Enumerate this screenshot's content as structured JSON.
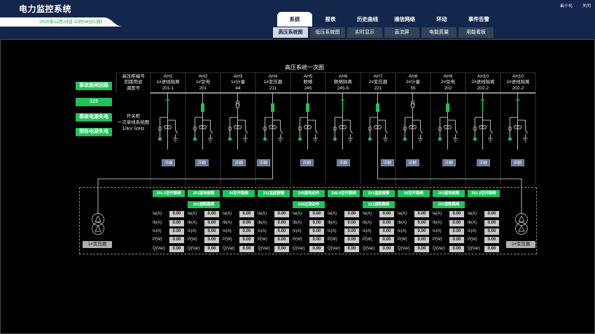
{
  "app": {
    "title": "电力监控系统",
    "datetime": "2020年11月24日 11时04分13秒",
    "minimize_label": "最小化",
    "close_label": "关闭"
  },
  "main_nav": [
    {
      "label": "系统",
      "active": true
    },
    {
      "label": "报表",
      "active": false
    },
    {
      "label": "历史曲线",
      "active": false
    },
    {
      "label": "通信网络",
      "active": false
    },
    {
      "label": "环动",
      "active": false
    },
    {
      "label": "事件告警",
      "active": false
    }
  ],
  "sub_nav": [
    {
      "label": "高压系统图",
      "active": true
    },
    {
      "label": "低压系统图",
      "active": false
    },
    {
      "label": "实时显示",
      "active": false
    },
    {
      "label": "直流屏",
      "active": false
    },
    {
      "label": "电能质量",
      "active": false
    },
    {
      "label": "用能看板",
      "active": false
    }
  ],
  "diagram": {
    "title": "高压系统一次图",
    "alarm_buttons": [
      {
        "label": "事故跳闸回路"
      },
      {
        "label": "123"
      },
      {
        "label": "事故电源失电"
      },
      {
        "label": "预告电源失电"
      }
    ],
    "row_headers": {
      "cabinet_no": "高压柜编号",
      "purpose": "回路用途",
      "dispatch_no": "调度号"
    },
    "system_note": {
      "line1": "开关柜",
      "line2": "一次单线系统图",
      "line3": "10kV    50Hz"
    },
    "detail_label": "详细",
    "measure_labels": [
      "Ia(A)",
      "Ib(A)",
      "Ic(A)",
      "P(W)",
      "Q(Var)"
    ],
    "cabinets": [
      {
        "id": "AH1",
        "purpose": "1#进线隔离",
        "dispatch": "201-1",
        "symbol": "disconnector-icon",
        "alarms": [
          "201-1空开跳闸"
        ],
        "measurements": [
          "0.00",
          "0.00",
          "0.00",
          "0.00",
          "0.00"
        ]
      },
      {
        "id": "AH2",
        "purpose": "1#受电",
        "dispatch": "201",
        "symbol": "breaker-icon",
        "alarms": [
          "201接地故障",
          "201速断跳闸"
        ],
        "measurements": [
          "0.00",
          "0.00",
          "0.00",
          "0.00",
          "0.00"
        ]
      },
      {
        "id": "AH3",
        "purpose": "1#计量",
        "dispatch": "44",
        "symbol": "metering-icon",
        "alarms": [
          "44空开跳闸"
        ],
        "measurements": [
          "0.00",
          "0.00",
          "0.00",
          "0.00",
          "0.00"
        ]
      },
      {
        "id": "AH4",
        "purpose": "1#变压器",
        "dispatch": "211",
        "symbol": "breaker-icon",
        "alarms": [
          "211温度报警"
        ],
        "measurements": [
          "0.00",
          "0.00",
          "0.00",
          "0.00",
          "0.00"
        ]
      },
      {
        "id": "AH5",
        "purpose": "联络",
        "dispatch": "245",
        "symbol": "breaker-icon",
        "alarms": [
          "245接地动作",
          "245过流动作"
        ],
        "measurements": [
          "0.00",
          "0.00",
          "0.00",
          "0.00",
          "0.00"
        ]
      },
      {
        "id": "AH6",
        "purpose": "联络隔离",
        "dispatch": "245-5",
        "symbol": "disconnector-icon",
        "alarms": [
          "245-5空开跳闸"
        ],
        "measurements": [
          "0.00",
          "0.00",
          "0.00",
          "0.00",
          "0.00"
        ]
      },
      {
        "id": "AH7",
        "purpose": "2#变压器",
        "dispatch": "221",
        "symbol": "breaker-icon",
        "alarms": [
          "221温度报警",
          "221速断跳闸"
        ],
        "measurements": [
          "0.00",
          "0.00",
          "0.00",
          "0.00",
          "0.00"
        ]
      },
      {
        "id": "AH8",
        "purpose": "2#计量",
        "dispatch": "55",
        "symbol": "metering-icon",
        "alarms": [
          "55空开跳闸"
        ],
        "measurements": [
          "0.00",
          "0.00",
          "0.00",
          "0.00",
          "0.00"
        ]
      },
      {
        "id": "AH9",
        "purpose": "2#受电",
        "dispatch": "202",
        "symbol": "breaker-icon",
        "alarms": [
          "202接地故障",
          "202速断跳闸"
        ],
        "measurements": [
          "0.00",
          "0.00",
          "0.00",
          "0.00",
          "0.00"
        ]
      },
      {
        "id": "AH10",
        "purpose": "2#进线隔离",
        "dispatch": "202-2",
        "symbol": "disconnector-icon",
        "alarms": [
          "202-2空开跳闸"
        ],
        "measurements": [
          "0.00",
          "0.00",
          "0.00",
          "0.00",
          "0.00"
        ]
      },
      {
        "id": "AH10",
        "purpose": "2#进线隔离",
        "dispatch": "202-2",
        "symbol": "disconnector-icon",
        "alarms": []
      }
    ],
    "transformers": [
      {
        "label": "1#变压器",
        "icon": "transformer-icon"
      },
      {
        "label": "2#变压器",
        "icon": "transformer-icon"
      }
    ]
  },
  "colors": {
    "header_bg": "#13264b",
    "panel_bg": "#000000",
    "accent_green": "#1fc25a",
    "line": "#e6e6e6",
    "divider": "#5a5a5a",
    "detail_button": "#5f7190",
    "date_text": "#17a34a"
  }
}
